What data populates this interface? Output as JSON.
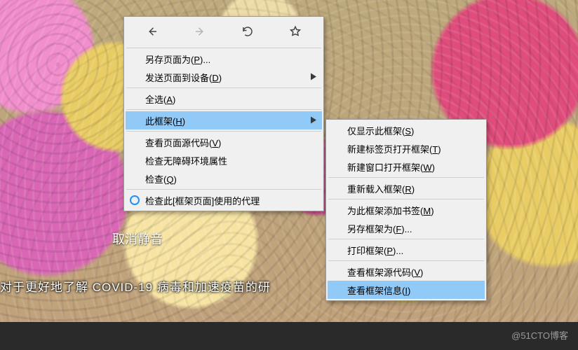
{
  "overlay": {
    "unmute_text": "取消静音",
    "subtitle": "对于更好地了解 COVID-19 病毒和加速疫苗的研"
  },
  "watermark": "@51CTO博客",
  "menu_primary": {
    "save_as": {
      "pre": "另存页面为(",
      "key": "P",
      "post": ")..."
    },
    "send_to_device": {
      "pre": "发送页面到设备(",
      "key": "D",
      "post": ")"
    },
    "select_all": {
      "pre": "全选(",
      "key": "A",
      "post": ")"
    },
    "this_frame": {
      "pre": "此框架(",
      "key": "H",
      "post": ")"
    },
    "view_source": {
      "pre": "查看页面源代码(",
      "key": "V",
      "post": ")"
    },
    "a11y_props": "检查无障碍环境属性",
    "inspect": {
      "pre": "检查(",
      "key": "Q",
      "post": ")"
    },
    "inspect_proxy": "检查此[框架页面]使用的代理"
  },
  "menu_frame": {
    "show_only": {
      "pre": "仅显示此框架(",
      "key": "S",
      "post": ")"
    },
    "open_tab": {
      "pre": "新建标签页打开框架(",
      "key": "T",
      "post": ")"
    },
    "open_window": {
      "pre": "新建窗口打开框架(",
      "key": "W",
      "post": ")"
    },
    "reload": {
      "pre": "重新载入框架(",
      "key": "R",
      "post": ")"
    },
    "bookmark": {
      "pre": "为此框架添加书签(",
      "key": "M",
      "post": ")"
    },
    "save_as": {
      "pre": "另存框架为(",
      "key": "F",
      "post": ")..."
    },
    "print": {
      "pre": "打印框架(",
      "key": "P",
      "post": ")..."
    },
    "view_source": {
      "pre": "查看框架源代码(",
      "key": "V",
      "post": ")"
    },
    "view_info": {
      "pre": "查看框架信息(",
      "key": "I",
      "post": ")"
    }
  }
}
